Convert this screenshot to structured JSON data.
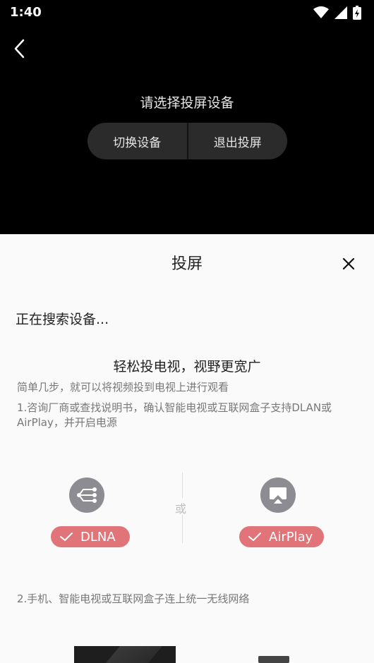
{
  "status_bar": {
    "time": "1:40",
    "icons": [
      "wifi-icon",
      "signal-icon",
      "battery-charging-icon"
    ]
  },
  "top": {
    "back_icon": "chevron-left-icon",
    "prompt": "请选择投屏设备",
    "switch_label": "切换设备",
    "exit_label": "退出投屏"
  },
  "sheet": {
    "title": "投屏",
    "close_icon": "close-icon",
    "searching": "正在搜索设备...",
    "headline": "轻松投电视，视野更宽广",
    "subline": "简单几步，就可以将视频投到电视上进行观看",
    "step1": "1.咨询厂商或查找说明书，确认智能电视或互联网盒子支持DLAN或AirPlay，并开启电源",
    "or": "或",
    "dlna_label": "DLNA",
    "airplay_label": "AirPlay",
    "step2": "2.手机、智能电视或互联网盒子连上统一无线网络"
  },
  "colors": {
    "badge": "#e07478",
    "protocol_icon_bg": "#8c8c92",
    "sheet_bg": "#fafafa"
  }
}
